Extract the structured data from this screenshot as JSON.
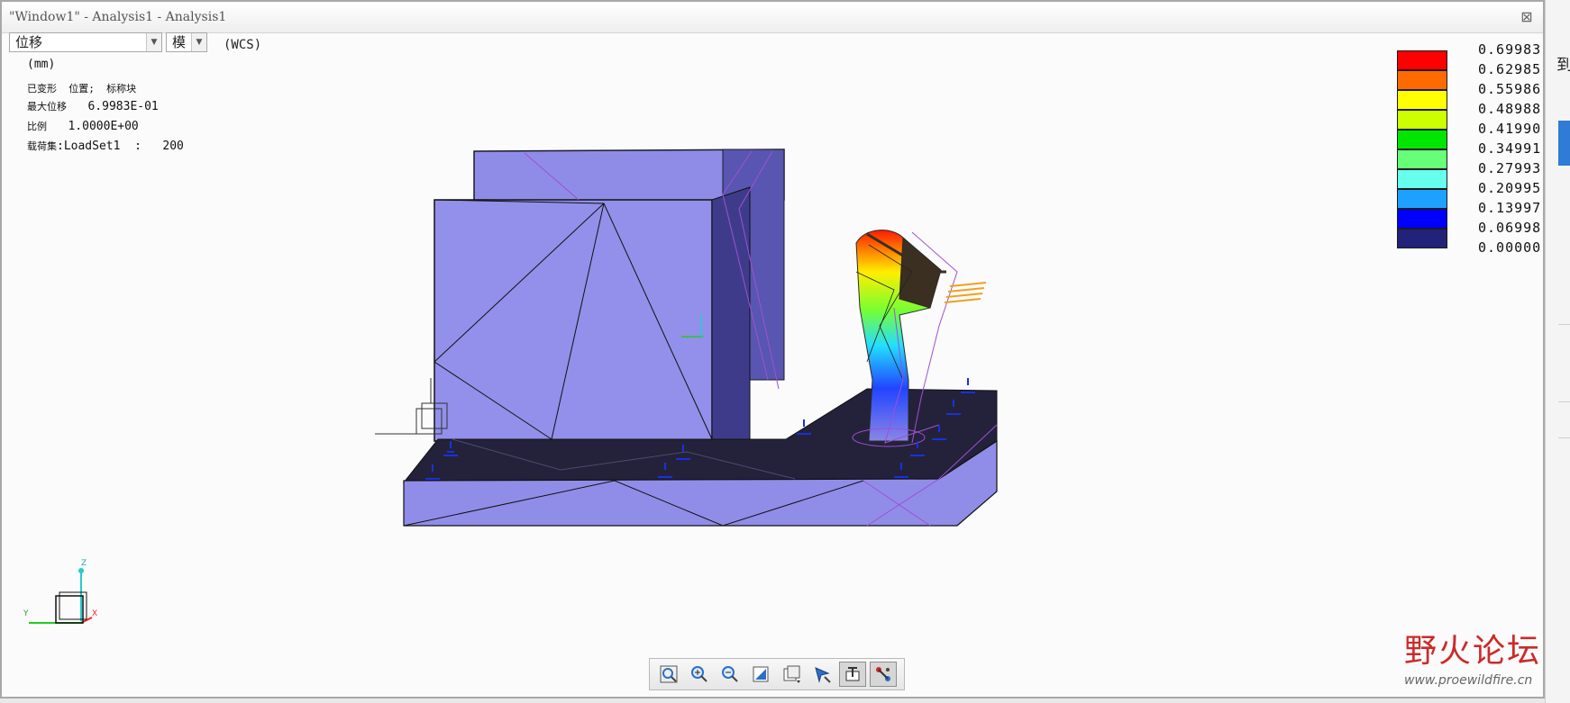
{
  "window": {
    "title": "\"Window1\" - Analysis1 - Analysis1",
    "close_glyph": "⊠"
  },
  "toolbar_row": {
    "quantity_select": "位移",
    "component_select": "模",
    "coordinate_system": "(WCS)"
  },
  "info": {
    "units": "(mm)",
    "deformed_line": "已变形  位置;  标称块",
    "max_disp_label": "最大位移",
    "max_disp_value": "6.9983E-01",
    "scale_label": "比例",
    "scale_value": "1.0000E+00",
    "loadset_label": "载荷集",
    "loadset_value": ":LoadSet1  :   200"
  },
  "legend": {
    "colors": [
      "#ff0000",
      "#ff6a00",
      "#ffff00",
      "#ccff00",
      "#00e600",
      "#66ff77",
      "#66ffee",
      "#1ea0ff",
      "#0000ff",
      "#22227a"
    ],
    "values": [
      "0.69983",
      "0.62985",
      "0.55986",
      "0.48988",
      "0.41990",
      "0.34991",
      "0.27993",
      "0.20995",
      "0.13997",
      "0.06998",
      "0.00000"
    ]
  },
  "triad": {
    "z_label": "Z",
    "x_label": "X",
    "y_label": "Y"
  },
  "bottom_toolbar": {
    "buttons": [
      {
        "name": "zoom-fit-icon",
        "active": false
      },
      {
        "name": "zoom-in-icon",
        "active": false
      },
      {
        "name": "zoom-out-icon",
        "active": false
      },
      {
        "name": "repaint-icon",
        "active": false
      },
      {
        "name": "display-style-icon",
        "active": false
      },
      {
        "name": "saved-views-icon",
        "active": false
      },
      {
        "name": "show-loads-icon",
        "active": true
      },
      {
        "name": "show-constraints-icon",
        "active": true
      }
    ]
  },
  "watermark": {
    "cn": "野火论坛",
    "url": "www.proewildfire.cn"
  },
  "right_panel": {
    "text": "到"
  }
}
